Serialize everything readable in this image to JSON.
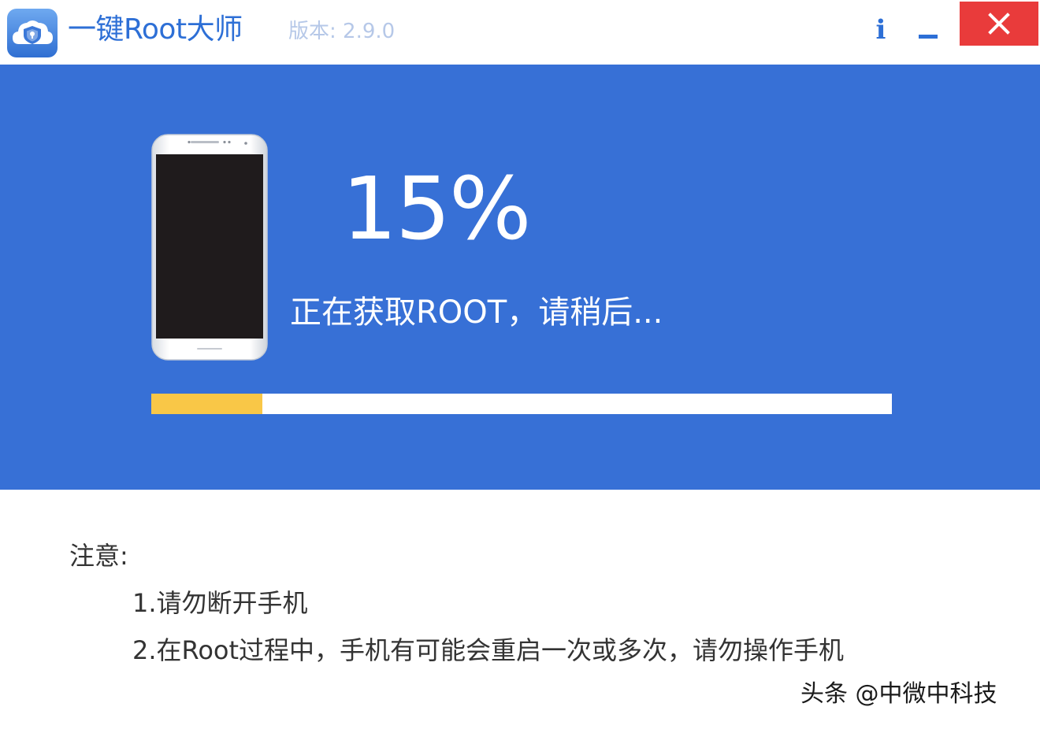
{
  "window": {
    "title": "一键Root大师",
    "version": "版本: 2.9.0",
    "info_label": "i"
  },
  "icons": {
    "logo": "cloud-shield-logo-icon",
    "info": "info-icon",
    "minimize": "minimize-icon",
    "close": "close-icon",
    "device": "phone-icon"
  },
  "colors": {
    "accent": "#2d6fd6",
    "panel": "#3770d6",
    "progress_fill": "#f9c747",
    "close": "#e93b3b"
  },
  "progress": {
    "percent_text": "15%",
    "value": 0.15,
    "status": "正在获取ROOT，请稍后..."
  },
  "notes": {
    "title": "注意:",
    "items": [
      "1.请勿断开手机",
      "2.在Root过程中，手机有可能会重启一次或多次，请勿操作手机"
    ]
  },
  "watermark": "头条 @中微中科技"
}
